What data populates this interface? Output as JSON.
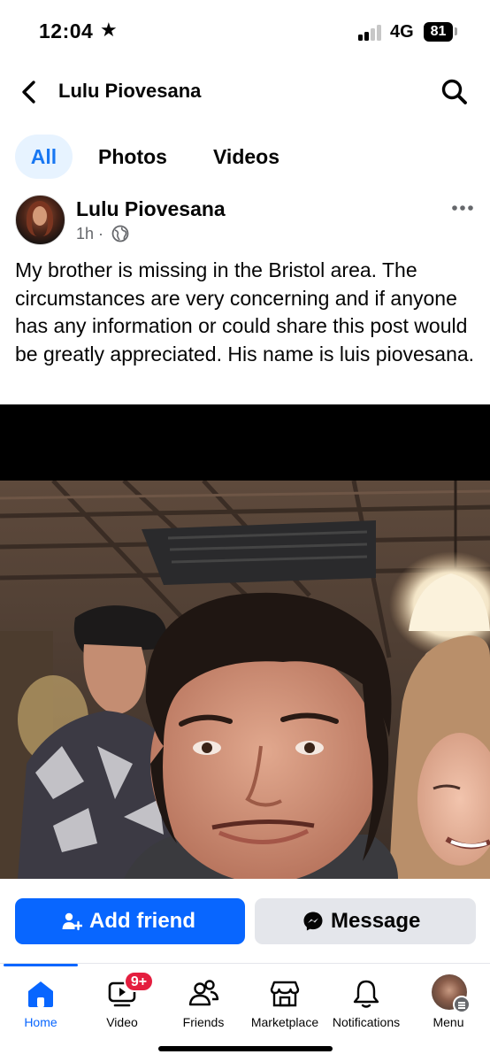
{
  "status_bar": {
    "time": "12:04",
    "star": "★",
    "network": "4G",
    "battery": "81"
  },
  "header": {
    "title": "Lulu Piovesana",
    "back_icon": "chevron-left-icon",
    "search_icon": "search-icon"
  },
  "tabs": [
    {
      "label": "All",
      "active": true
    },
    {
      "label": "Photos",
      "active": false
    },
    {
      "label": "Videos",
      "active": false
    }
  ],
  "post": {
    "author": "Lulu Piovesana",
    "time": "1h",
    "separator": "·",
    "audience_icon": "globe-icon",
    "more_icon": "more-horizontal-icon",
    "text": "My brother is missing in the Bristol area. The circumstances are very concerning and if anyone has any information or could share this post would be greatly appreciated. His name is luis piovesana."
  },
  "actions": {
    "add_friend": "Add friend",
    "message": "Message"
  },
  "bottom_nav": [
    {
      "label": "Home",
      "icon": "home-icon",
      "active": true
    },
    {
      "label": "Video",
      "icon": "video-icon",
      "badge": "9+"
    },
    {
      "label": "Friends",
      "icon": "friends-icon"
    },
    {
      "label": "Marketplace",
      "icon": "marketplace-icon"
    },
    {
      "label": "Notifications",
      "icon": "bell-icon"
    },
    {
      "label": "Menu",
      "icon": "profile-avatar-icon"
    }
  ],
  "colors": {
    "accent": "#0866ff",
    "tab_active_bg": "#e7f3ff",
    "secondary_button": "#e4e6eb",
    "badge": "#e41e3f",
    "meta_text": "#65676b"
  }
}
